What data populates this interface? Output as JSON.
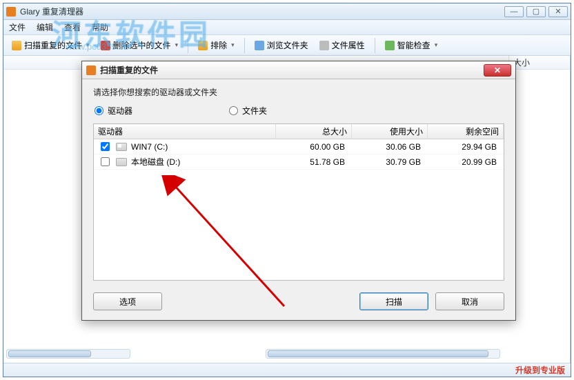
{
  "main_window": {
    "title": "Glary 重复清理器",
    "menu": {
      "file": "文件",
      "edit": "编辑",
      "view": "查看",
      "help": "帮助"
    },
    "toolbar": {
      "scan": "扫描重复的文件",
      "delete": "删除选中的文件",
      "sort": "排除",
      "browse": "浏览文件夹",
      "props": "文件属性",
      "smart": "智能检查"
    },
    "columns": {
      "size": "大小"
    },
    "statusbar": {
      "upgrade": "升级到专业版"
    }
  },
  "watermark": {
    "big": "河东软件园",
    "url": "www.pc0359.cn"
  },
  "dialog": {
    "title": "扫描重复的文件",
    "instruction": "请选择你想搜索的驱动器或文件夹",
    "radio": {
      "drives": "驱动器",
      "folders": "文件夹"
    },
    "headers": {
      "drive": "驱动器",
      "total": "总大小",
      "used": "使用大小",
      "free": "剩余空间"
    },
    "rows": [
      {
        "checked": true,
        "name": "WIN7 (C:)",
        "total": "60.00 GB",
        "used": "30.06 GB",
        "free": "29.94 GB"
      },
      {
        "checked": false,
        "name": "本地磁盘 (D:)",
        "total": "51.78 GB",
        "used": "30.79 GB",
        "free": "20.99 GB"
      }
    ],
    "buttons": {
      "options": "选项",
      "scan": "扫描",
      "cancel": "取消"
    }
  }
}
